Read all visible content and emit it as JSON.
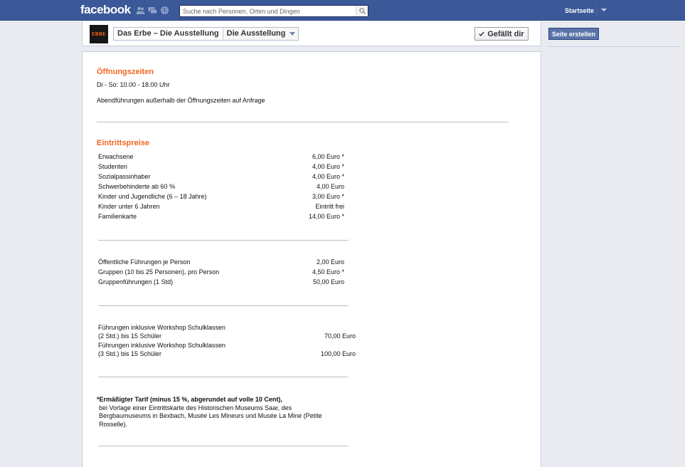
{
  "topbar": {
    "logo": "facebook",
    "search_placeholder": "Suche nach Personen, Orten und Dingen",
    "home_label": "Startseite"
  },
  "page_header": {
    "logo_text": "ERBE",
    "page_name": "Das Erbe – Die Ausstellung",
    "current_tab": "Die Ausstellung",
    "like_label": "Gefällt dir"
  },
  "right_column": {
    "create_page_label": "Seite erstellen"
  },
  "content": {
    "hours_title": "Öffnungszeiten",
    "hours_text": "Di - So: 10.00 - 18.00 Uhr",
    "evening_text": "Abendführungen außerhalb der Öffnungszeiten auf Anfrage",
    "prices_title": "Eintrittspreise",
    "prices": [
      {
        "label": "Erwachsene",
        "value": "6,00 Euro *"
      },
      {
        "label": "Studenten",
        "value": "4,00 Euro *"
      },
      {
        "label": "Sozialpassinhaber",
        "value": "4,00 Euro *"
      },
      {
        "label": "Schwerbehinderte ab 60 %",
        "value": "4,00 Euro"
      },
      {
        "label": "Kinder und Jugendliche (6 – 18 Jahre)",
        "value": "3,00 Euro *"
      },
      {
        "label": "Kinder unter 6 Jahren",
        "value": "Eintritt frei"
      },
      {
        "label": "Familienkarte",
        "value": "14,00 Euro *"
      }
    ],
    "tours": [
      {
        "label": "Öffentliche Führungen je Person",
        "value": "2,00 Euro"
      },
      {
        "label": "Gruppen (10 bis 25 Personen), pro Person",
        "value": "4,50 Euro *"
      },
      {
        "label": "Gruppenführungen (1 Std)",
        "value": "50,00 Euro"
      }
    ],
    "workshops": [
      {
        "line1": "Führungen inklusive Workshop Schulklassen",
        "line2": "(2 Std.) bis 15 Schüler",
        "value": "70,00 Euro"
      },
      {
        "line1": "Führungen inklusive Workshop Schulklassen",
        "line2": "(3 Std.) bis 15 Schüler",
        "value": "100,00 Euro"
      }
    ],
    "note_bold": "*Ermäßigter Tarif (minus 15 %, abgerundet auf volle 10 Cent),",
    "note_text": "bei Vorlage einer Eintrittskarte des Historischen Museums Saar, des Bergbaumuseums in Bexbach, Musée Les Mineurs und Musée La Mine (Petite Rosselle)."
  },
  "colors": {
    "brand_blue": "#3b5998",
    "section_orange": "#f26522"
  },
  "icons": [
    "friends-icon",
    "messages-icon",
    "notifications-icon",
    "search-icon",
    "chevron-down-icon",
    "checkmark-icon"
  ]
}
